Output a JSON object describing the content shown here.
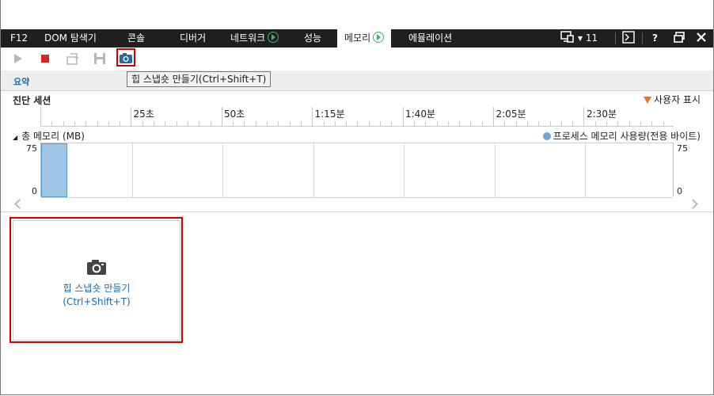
{
  "tabs": [
    {
      "label": "F12"
    },
    {
      "label": "DOM 탐색기"
    },
    {
      "label": "콘솔"
    },
    {
      "label": "디버거"
    },
    {
      "label": "네트워크"
    },
    {
      "label": "성능"
    },
    {
      "label": "메모리"
    },
    {
      "label": "에뮬레이션"
    }
  ],
  "toolbar_right": {
    "target_count": "11",
    "help": "?"
  },
  "tooltip": "힙 스냅숏 만들기(Ctrl+Shift+T)",
  "summary_tab": "요약",
  "diagnostic_session": "진단 세션",
  "user_marks": "사용자 표시",
  "ruler_labels": [
    "25초",
    "50초",
    "1:15분",
    "1:40분",
    "2:05분",
    "2:30분"
  ],
  "memory_chart": {
    "title": "총 메모리 (MB)",
    "legend": "프로세스 메모리 사용량(전용 바이트)"
  },
  "chart_data": {
    "type": "bar",
    "title": "총 메모리 (MB)",
    "ylim": [
      0,
      75
    ],
    "y_ticks": [
      "75",
      "0"
    ],
    "series": [
      {
        "name": "프로세스 메모리 사용량(전용 바이트)",
        "values": [
          75
        ]
      }
    ],
    "x_ticks": [
      "25초",
      "50초",
      "1:15분",
      "1:40분",
      "2:05분",
      "2:30분"
    ]
  },
  "snapshot_card": {
    "line1": "힙 스냅숏 만들기",
    "line2": "(Ctrl+Shift+T)"
  },
  "colors": {
    "accent": "#1f6aa5",
    "highlight": "#d00000",
    "bar": "#9fc7e5",
    "active_play": "#3fb36b"
  }
}
